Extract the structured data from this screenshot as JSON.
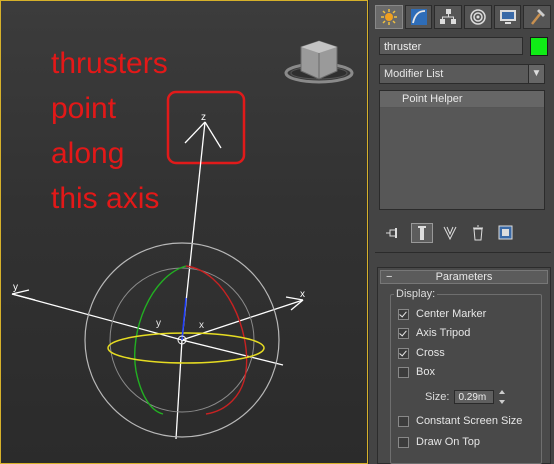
{
  "annotation": {
    "lines": [
      "thrusters",
      "point",
      "along",
      "this axis"
    ]
  },
  "viewport": {
    "gizmo_labels": {
      "tripod_z": "z",
      "tripod_y": "y",
      "tripod_x": "x",
      "center_y": "y",
      "center_x": "x"
    },
    "colors": {
      "highlight_box": "#e11a1a",
      "ring_x": "#d02020",
      "ring_y": "#20c020",
      "ring_z": "#e8e020",
      "local_axis": "#2040ff",
      "border": "#d6b12a"
    }
  },
  "command_panel": {
    "tabs": [
      {
        "icon": "sun-create-icon"
      },
      {
        "icon": "curve-modify-icon"
      },
      {
        "icon": "hierarchy-icon"
      },
      {
        "icon": "motion-icon"
      },
      {
        "icon": "display-monitor-icon"
      },
      {
        "icon": "hammer-utilities-icon"
      }
    ],
    "object_name": "thruster",
    "object_color": "#10ec16",
    "modifier_list": "Modifier List",
    "stack": [
      "Point Helper"
    ],
    "rollout": {
      "title": "Parameters",
      "collapse_symbol": "−",
      "display_label": "Display:",
      "checkboxes": [
        {
          "label": "Center Marker",
          "checked": true
        },
        {
          "label": "Axis Tripod",
          "checked": true
        },
        {
          "label": "Cross",
          "checked": true
        },
        {
          "label": "Box",
          "checked": false
        },
        {
          "label": "Constant Screen Size",
          "checked": false
        },
        {
          "label": "Draw On Top",
          "checked": false
        }
      ],
      "size_label": "Size:",
      "size_value": "0.29m"
    }
  }
}
